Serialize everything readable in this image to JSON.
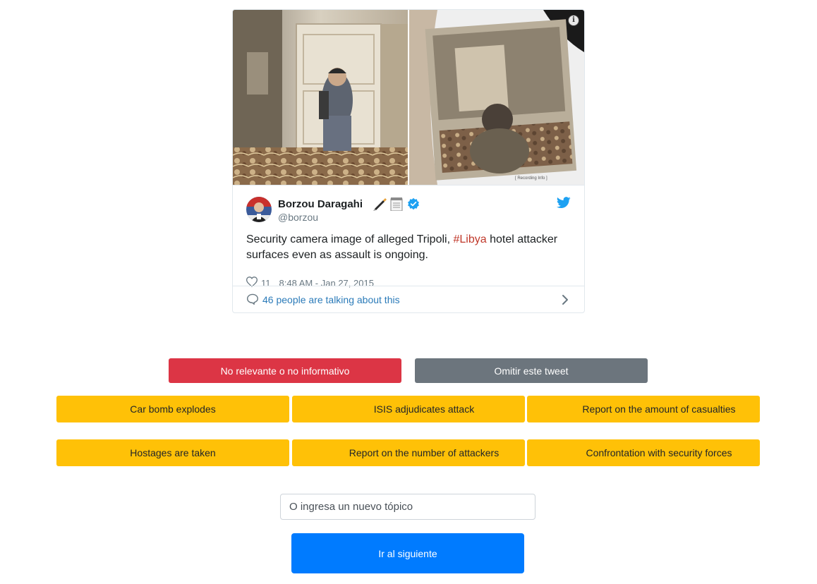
{
  "tweet": {
    "author_name": "Borzou Daragahi",
    "name_emojis": [
      "pen-icon",
      "notepad-icon"
    ],
    "handle": "@borzou",
    "text_before": "Security camera image of alleged Tripoli, ",
    "hashtag": "#Libya",
    "text_after": " hotel attacker surfaces even as assault is ongoing.",
    "likes": "11",
    "timestamp": "8:48 AM - Jan 27, 2015",
    "talking": "46 people are talking about this",
    "photo_caption": "[ Recording Info ]",
    "colors": {
      "hashtag": "#c0392b",
      "link": "#2b7bb9",
      "verified": "#1da1f2",
      "bird": "#1da1f2"
    }
  },
  "actions": {
    "not_relevant": "No relevante o no informativo",
    "skip": "Omitir este tweet"
  },
  "topics": [
    "Car bomb explodes",
    "ISIS adjudicates attack",
    "Report on the amount of casualties",
    "Hostages are taken",
    "Report on the number of attackers",
    "Confrontation with security forces"
  ],
  "new_topic": {
    "placeholder": "O ingresa un nuevo tópico"
  },
  "next": {
    "label": "Ir al siguiente"
  },
  "theme": {
    "red": "#dc3545",
    "gray": "#6c757d",
    "yellow": "#ffc107",
    "blue": "#007bff"
  }
}
